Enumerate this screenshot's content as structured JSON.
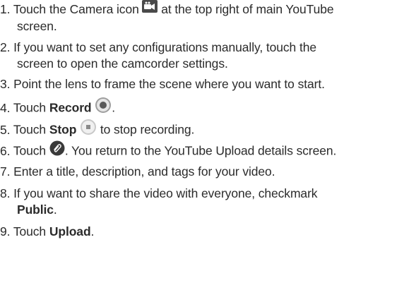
{
  "steps": [
    {
      "number": "1.",
      "text_before_icon": "Touch the Camera icon",
      "icon": "camera-icon",
      "text_after_icon": "at the top right of main YouTube",
      "continuation": "screen."
    },
    {
      "number": "2.",
      "line1": "If you want to set any configurations manually, touch the",
      "line2": "screen to open the camcorder settings."
    },
    {
      "number": "3.",
      "text": "Point the lens to frame the scene where you want to start."
    },
    {
      "number": "4.",
      "text": "Touch",
      "bold": "Record",
      "icon": "record-icon",
      "after": "."
    },
    {
      "number": "5.",
      "text": "Touch",
      "bold": "Stop",
      "icon": "stop-icon",
      "after": "to stop recording."
    },
    {
      "number": "6.",
      "text": "Touch",
      "icon": "attach-icon",
      "after": ". You return to the YouTube Upload details screen."
    },
    {
      "number": "7.",
      "text": "Enter a title, description, and tags for your video."
    },
    {
      "number": "8.",
      "line1": "If you want to share the video with everyone, checkmark",
      "bold": "Public",
      "after": "."
    },
    {
      "number": "9.",
      "text": "Touch",
      "bold": "Upload",
      "after": "."
    }
  ],
  "colors": {
    "text": "#2b2b2b",
    "icon_dark": "#3a3a3a",
    "icon_gray": "#bdbdbd"
  }
}
